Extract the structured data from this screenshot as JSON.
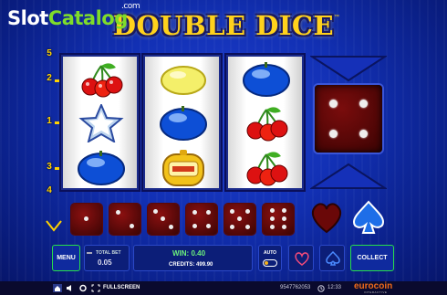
{
  "watermark": {
    "part1": "Slot",
    "part2": "Catalog",
    "tld": ".com"
  },
  "game": {
    "title": "DOUBLE DICE",
    "tm": "™"
  },
  "paylines": [
    "5",
    "2",
    "1",
    "3",
    "4"
  ],
  "reels": [
    {
      "symbols": [
        "cherries",
        "star",
        "plum"
      ]
    },
    {
      "symbols": [
        "lemon",
        "plum",
        "orange-bell"
      ]
    },
    {
      "symbols": [
        "plum",
        "cherries",
        "cherries"
      ]
    }
  ],
  "bonus_die": {
    "face": 4
  },
  "dice_row": {
    "faces": [
      1,
      2,
      3,
      4,
      5,
      6
    ]
  },
  "gamble": {
    "suits": [
      "heart",
      "spade"
    ]
  },
  "controls": {
    "menu_label": "MENU",
    "total_bet_label": "TOTAL BET",
    "total_bet_value": "0.05",
    "win_label": "WIN:",
    "win_value": "0.40",
    "credits_label": "CREDITS:",
    "credits_value": "499.90",
    "auto_label": "AUTO",
    "collect_label": "COLLECT"
  },
  "footer": {
    "fullscreen_label": "FULLSCREEN",
    "session_id": "9547762053",
    "clock": "12:33",
    "brand": "eurocoin",
    "brand_sub": "INTERACTIVE"
  },
  "colors": {
    "accent_green": "#25c23a",
    "gold": "#ffd200",
    "die_red": "#6a0808",
    "panel_blue": "#1230b4"
  }
}
